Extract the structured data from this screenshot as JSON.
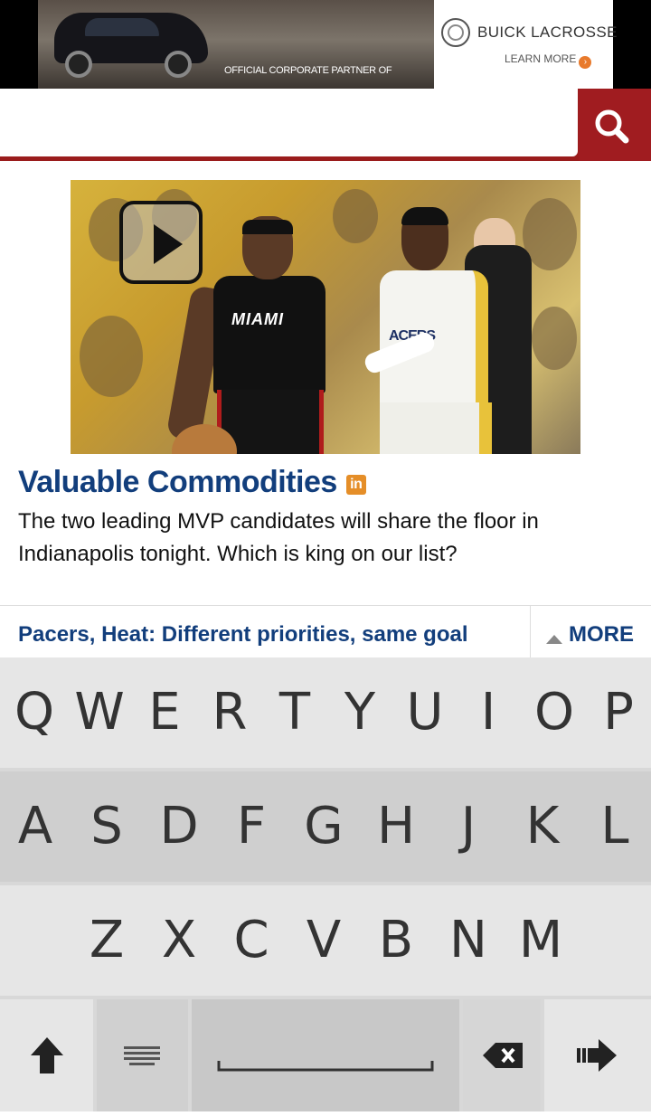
{
  "ad": {
    "partner_text": "OFFICIAL CORPORATE PARTNER OF",
    "brand": "BUICK LACROSSE",
    "cta": "LEARN MORE"
  },
  "search": {
    "placeholder": "",
    "value": ""
  },
  "article": {
    "headline": "Valuable Commodities",
    "summary": "The two leading MVP candidates will share the floor in Indianapolis tonight. Which is king on our list?",
    "jersey_left": "MIAMI",
    "jersey_right": "ACERS"
  },
  "related": {
    "link": "Pacers, Heat: Different priorities, same goal",
    "more_label": "MORE"
  },
  "keyboard": {
    "row1": [
      "Q",
      "W",
      "E",
      "R",
      "T",
      "Y",
      "U",
      "I",
      "O",
      "P"
    ],
    "row2": [
      "A",
      "S",
      "D",
      "F",
      "G",
      "H",
      "J",
      "K",
      "L"
    ],
    "row3": [
      "Z",
      "X",
      "C",
      "V",
      "B",
      "N",
      "M"
    ]
  },
  "colors": {
    "accent": "#a01c20",
    "link": "#123e7c"
  }
}
